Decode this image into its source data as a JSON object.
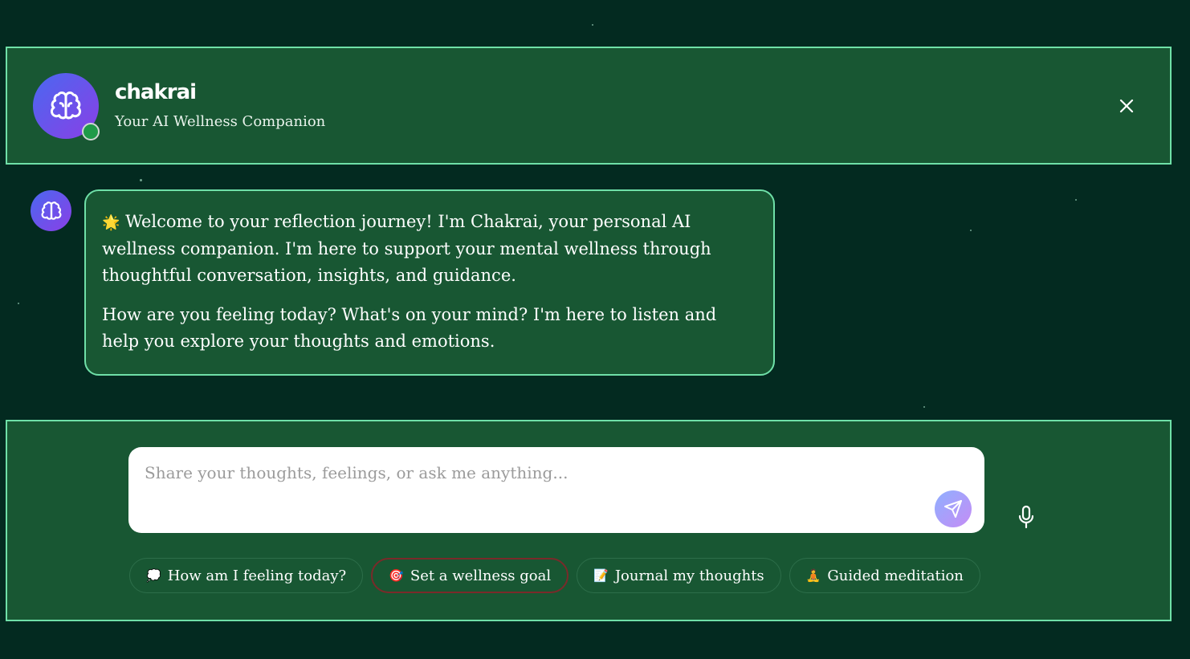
{
  "header": {
    "brand": "chakrai",
    "tagline": "Your AI Wellness Companion",
    "avatar_icon": "brain-icon",
    "status": "online",
    "close_icon": "close-icon"
  },
  "messages": [
    {
      "sender": "assistant",
      "avatar_icon": "brain-icon",
      "emoji": "🌟",
      "paragraph_1": "Welcome to your reflection journey! I'm Chakrai, your personal AI wellness companion. I'm here to support your mental wellness through thoughtful conversation, insights, and guidance.",
      "paragraph_2": "How are you feeling today? What's on your mind? I'm here to listen and help you explore your thoughts and emotions."
    }
  ],
  "composer": {
    "value": "",
    "placeholder": "Share your thoughts, feelings, or ask me anything...",
    "send_icon": "send-icon",
    "mic_icon": "microphone-icon"
  },
  "quick_actions": [
    {
      "emoji": "💭",
      "label": "How am I feeling today?"
    },
    {
      "emoji": "🎯",
      "label": "Set a wellness goal"
    },
    {
      "emoji": "📝",
      "label": "Journal my thoughts"
    },
    {
      "emoji": "🧘",
      "label": "Guided meditation"
    }
  ],
  "colors": {
    "background": "#032a20",
    "panel": "#185733",
    "accent_border": "#6fe0a8",
    "avatar_gradient_start": "#4a68f0",
    "avatar_gradient_end": "#8a3fe6",
    "online": "#1f9a48"
  }
}
